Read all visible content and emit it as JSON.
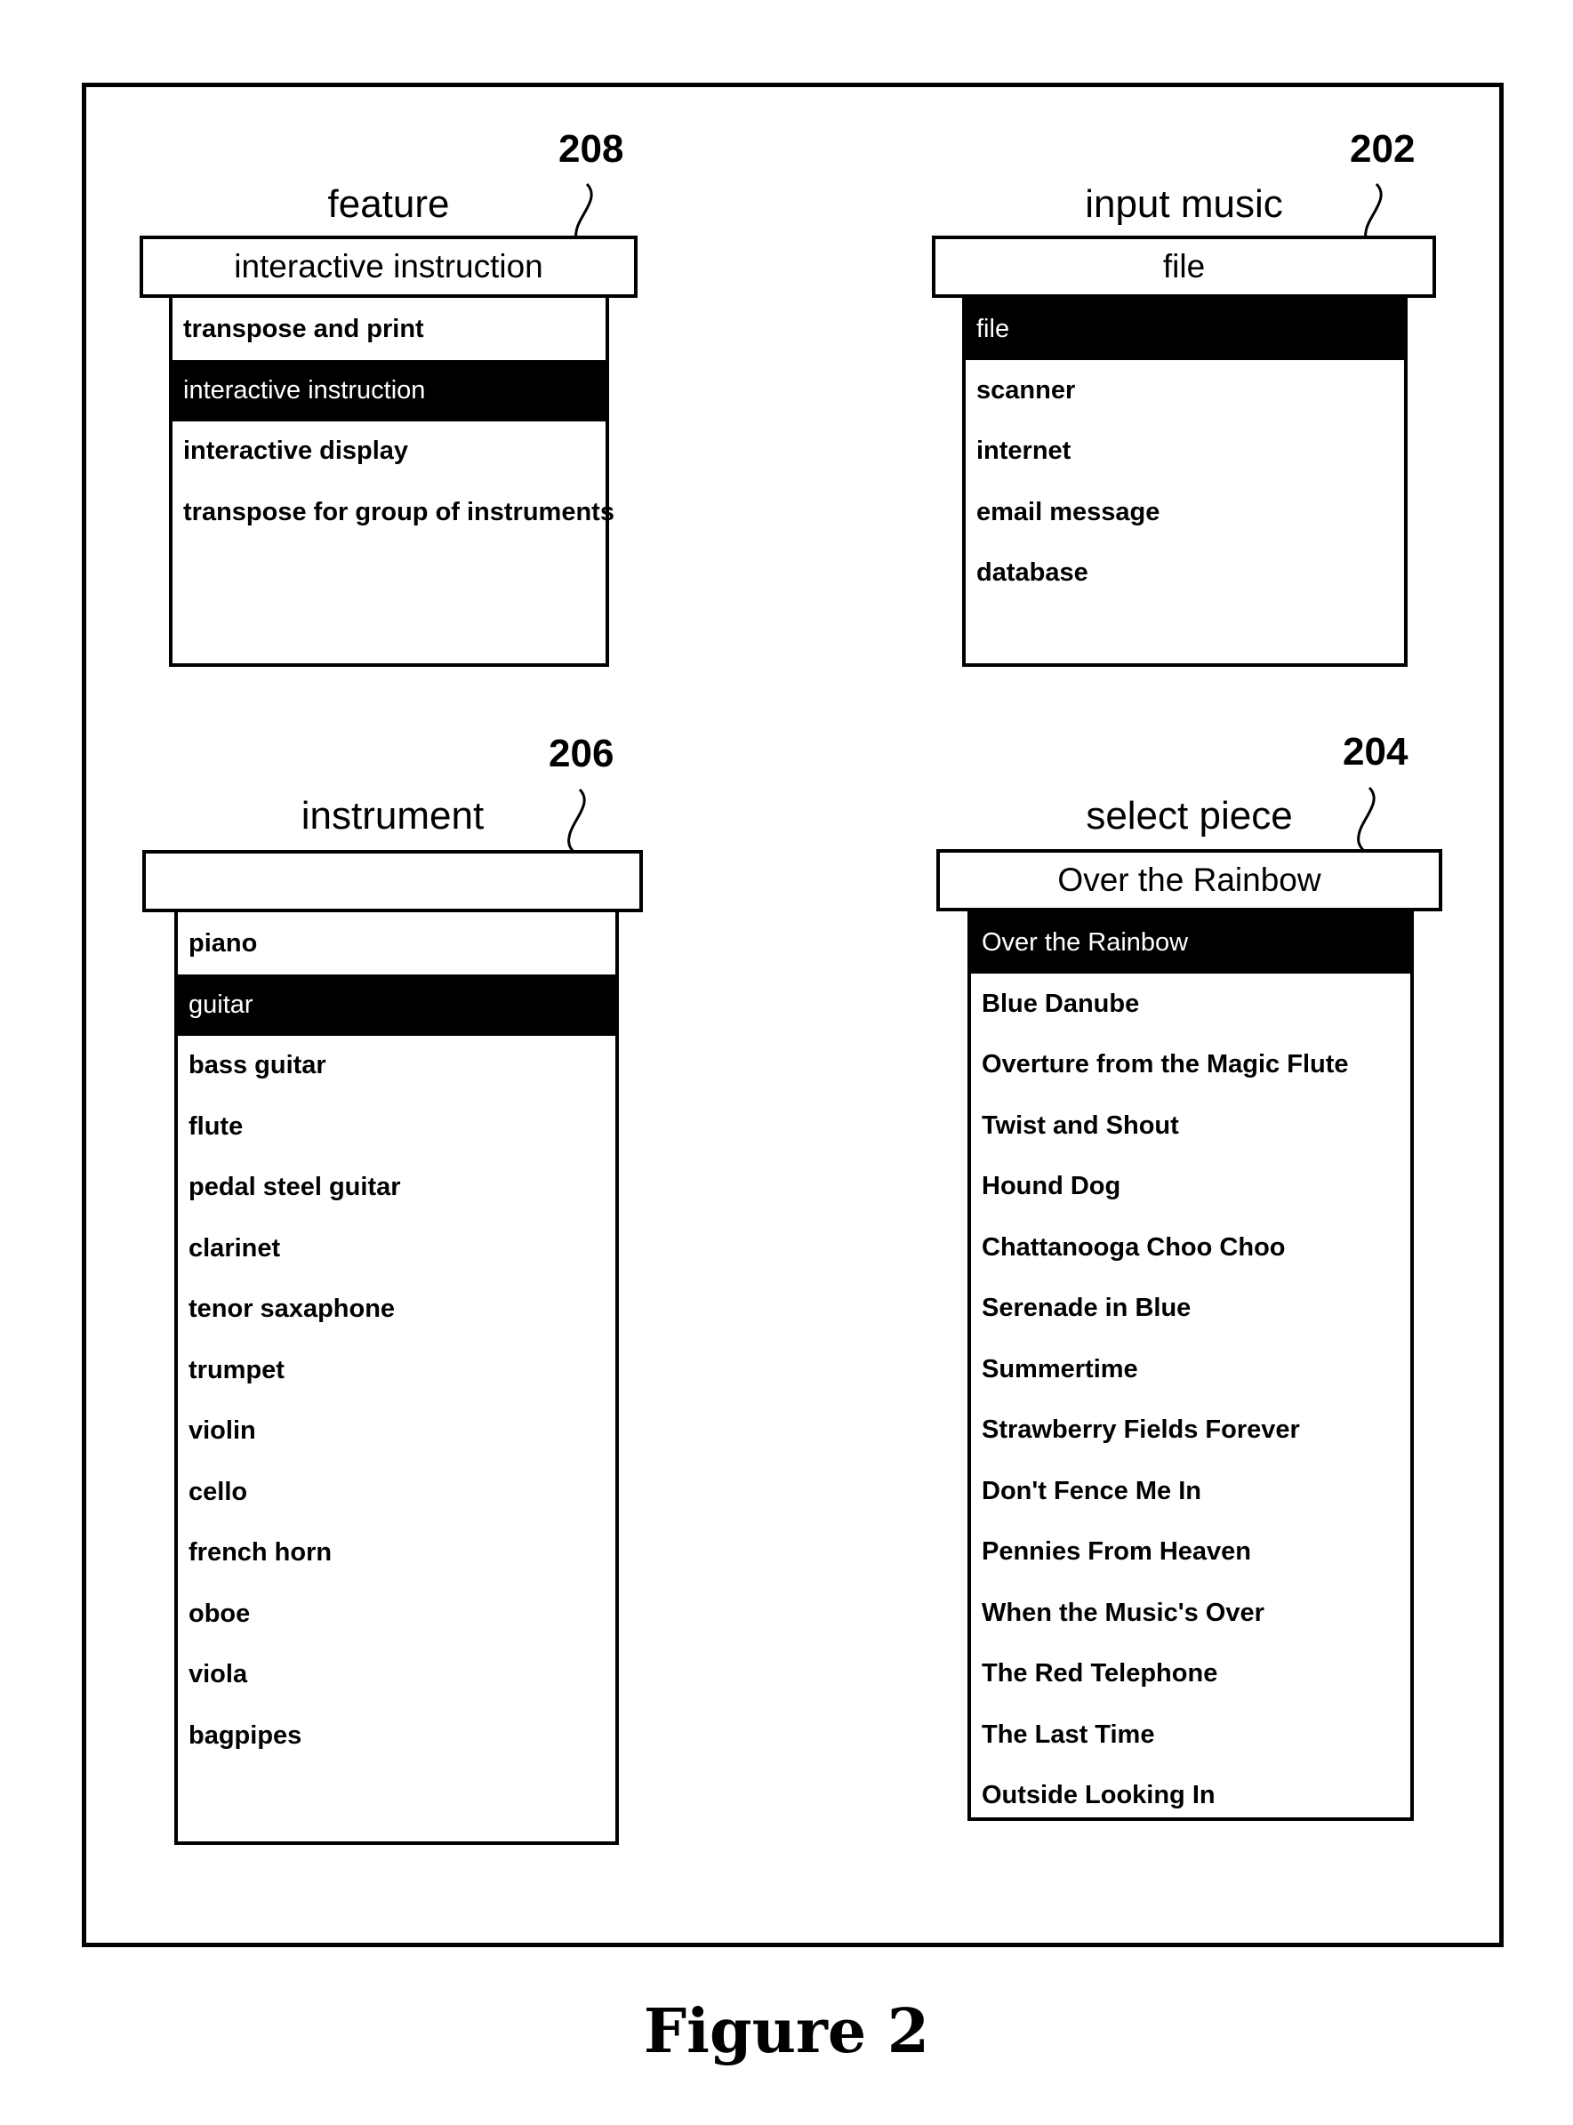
{
  "widgets": {
    "feature": {
      "ref_number": "208",
      "label": "feature",
      "selected_value": "interactive instruction",
      "options": [
        {
          "label": "transpose and print",
          "selected": false
        },
        {
          "label": "interactive instruction",
          "selected": true
        },
        {
          "label": "interactive display",
          "selected": false
        },
        {
          "label": "transpose for group of instruments",
          "selected": false
        }
      ]
    },
    "input_music": {
      "ref_number": "202",
      "label": "input music",
      "selected_value": "file",
      "options": [
        {
          "label": "file",
          "selected": true
        },
        {
          "label": "scanner",
          "selected": false
        },
        {
          "label": "internet",
          "selected": false
        },
        {
          "label": "email message",
          "selected": false
        },
        {
          "label": "database",
          "selected": false
        }
      ]
    },
    "instrument": {
      "ref_number": "206",
      "label": "instrument",
      "selected_value": "",
      "options": [
        {
          "label": "piano",
          "selected": false
        },
        {
          "label": "guitar",
          "selected": true
        },
        {
          "label": "bass guitar",
          "selected": false
        },
        {
          "label": "flute",
          "selected": false
        },
        {
          "label": "pedal steel guitar",
          "selected": false
        },
        {
          "label": "clarinet",
          "selected": false
        },
        {
          "label": "tenor saxaphone",
          "selected": false
        },
        {
          "label": "trumpet",
          "selected": false
        },
        {
          "label": "violin",
          "selected": false
        },
        {
          "label": "cello",
          "selected": false
        },
        {
          "label": "french horn",
          "selected": false
        },
        {
          "label": "oboe",
          "selected": false
        },
        {
          "label": "viola",
          "selected": false
        },
        {
          "label": "bagpipes",
          "selected": false
        }
      ]
    },
    "select_piece": {
      "ref_number": "204",
      "label": "select piece",
      "selected_value": "Over the Rainbow",
      "options": [
        {
          "label": "Over the Rainbow",
          "selected": true
        },
        {
          "label": "Blue Danube",
          "selected": false
        },
        {
          "label": "Overture from the Magic Flute",
          "selected": false
        },
        {
          "label": "Twist and Shout",
          "selected": false
        },
        {
          "label": "Hound Dog",
          "selected": false
        },
        {
          "label": "Chattanooga Choo Choo",
          "selected": false
        },
        {
          "label": "Serenade in Blue",
          "selected": false
        },
        {
          "label": "Summertime",
          "selected": false
        },
        {
          "label": "Strawberry Fields Forever",
          "selected": false
        },
        {
          "label": "Don't Fence Me In",
          "selected": false
        },
        {
          "label": "Pennies From Heaven",
          "selected": false
        },
        {
          "label": "When the Music's Over",
          "selected": false
        },
        {
          "label": "The Red Telephone",
          "selected": false
        },
        {
          "label": "The Last Time",
          "selected": false
        },
        {
          "label": "Outside Looking In",
          "selected": false
        }
      ]
    }
  },
  "caption": "Figure 2",
  "colors": {
    "selected_bg": "#000000",
    "selected_fg": "#ffffff",
    "line": "#000000"
  }
}
